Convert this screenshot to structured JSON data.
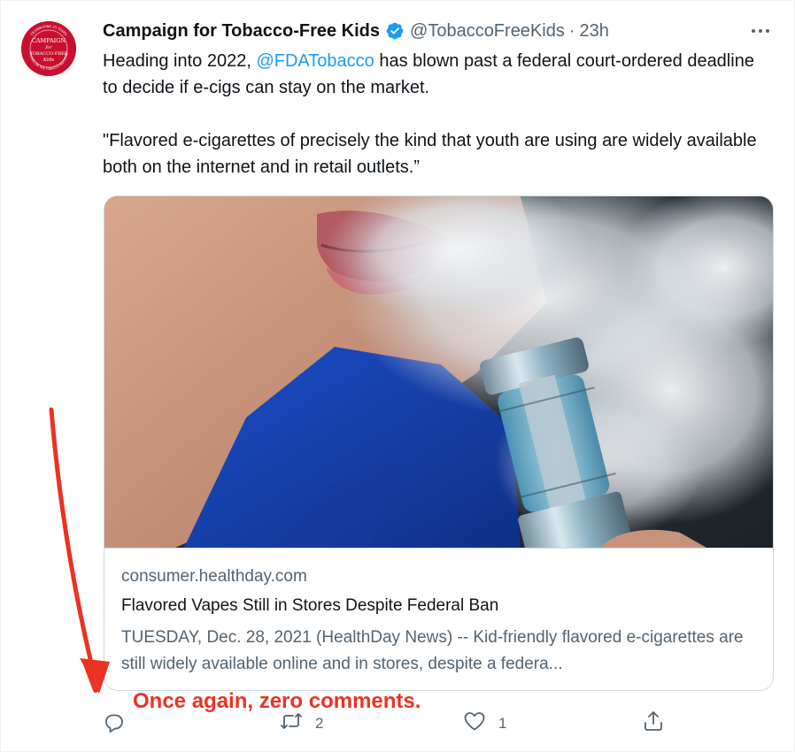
{
  "author": {
    "name": "Campaign for Tobacco-Free Kids",
    "handle": "@TobaccoFreeKids",
    "separator": "·",
    "time": "23h",
    "avatar_text": {
      "ring_top": "CELEBRATING 25 YEARS",
      "line1": "CAMPAIGN",
      "line2": "for",
      "line3": "TOBACCO-FREE",
      "line4": "Kids",
      "ring_bottom": "TAKING ON THE TOBACCO INDUSTRY"
    }
  },
  "tweet": {
    "text_before_mention": "Heading into 2022, ",
    "mention": "@FDATobacco",
    "text_after_mention": " has blown past a federal court-ordered deadline to decide if e-cigs can stay on the market.",
    "quote": "\"Flavored e-cigarettes of precisely the kind that youth are using are widely available both on the internet and in retail outlets.”"
  },
  "card": {
    "domain": "consumer.healthday.com",
    "title": "Flavored Vapes Still in Stores Despite Federal Ban",
    "description": "TUESDAY, Dec. 28, 2021 (HealthDay News) -- Kid-friendly flavored e-cigarettes are still widely available online and in stores, despite a federa..."
  },
  "actions": {
    "reply_count": "",
    "retweet_count": "2",
    "like_count": "1"
  },
  "annotation": {
    "text": "Once again, zero comments."
  },
  "icons": {
    "verified": "verified-badge-icon",
    "more": "more-options-icon",
    "reply": "reply-icon",
    "retweet": "retweet-icon",
    "like": "like-icon",
    "share": "share-icon"
  },
  "colors": {
    "link": "#1d9bf0",
    "secondary": "#536471",
    "annotation": "#ea3323",
    "avatar": "#c8102e"
  }
}
